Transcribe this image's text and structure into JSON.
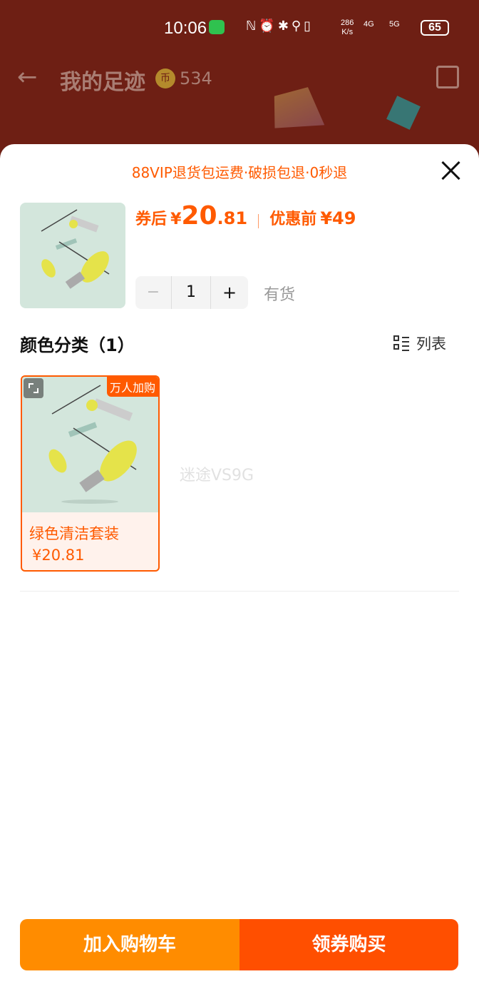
{
  "status_bar": {
    "time": "10:06",
    "net_speed_value": "286",
    "net_speed_unit": "K/s",
    "sig1": "4G",
    "sig2": "5G",
    "battery": "65"
  },
  "nav": {
    "title": "我的足迹",
    "coin_icon_text": "币",
    "coins": "534"
  },
  "sheet": {
    "vip_banner": "88VIP退货包运费·破损包退·0秒退",
    "price": {
      "after_label": "券后",
      "currency": "¥",
      "after_int": "20",
      "after_dec": ".81",
      "before_label": "优惠前",
      "before_value": "¥49"
    },
    "stepper": {
      "minus": "−",
      "quantity": "1",
      "plus": "+"
    },
    "stock": "有货",
    "section_title": "颜色分类（1）",
    "list_toggle": "列表",
    "sku": {
      "badge": "万人加购",
      "name": "绿色清洁套装",
      "price": "¥20.81"
    },
    "watermark": "迷途VS9G"
  },
  "footer": {
    "add_to_cart": "加入购物车",
    "buy_now": "领券购买"
  },
  "colors": {
    "accent": "#ff5a00",
    "cart": "#ff8c00",
    "buy": "#ff4f00"
  }
}
